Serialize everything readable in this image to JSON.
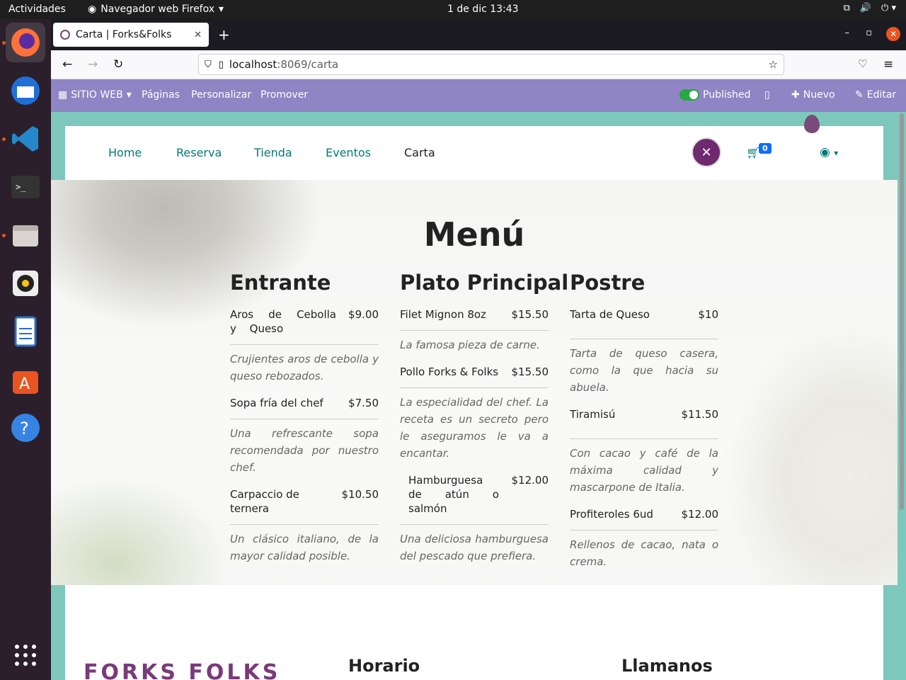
{
  "desktop": {
    "activities": "Actividades",
    "app_name": "Navegador web Firefox",
    "clock": "1 de dic  13:43"
  },
  "browser": {
    "tab_title": "Carta | Forks&Folks",
    "url_host": "localhost",
    "url_path": ":8069/carta"
  },
  "odoo_bar": {
    "website_label": "SITIO WEB",
    "pages": "Páginas",
    "customize": "Personalizar",
    "promote": "Promover",
    "published": "Published",
    "new": "Nuevo",
    "edit": "Editar"
  },
  "site": {
    "nav": [
      "Home",
      "Reserva",
      "Tienda",
      "Eventos",
      "Carta"
    ],
    "cart_count": "0",
    "menu_title": "Menú",
    "columns": [
      {
        "title": "Entrante",
        "items": [
          {
            "name": "Aros de Cebolla y Queso",
            "price": "$9.00",
            "desc": "Crujientes aros de cebolla y queso rebozados."
          },
          {
            "name": "Sopa fría del chef",
            "price": "$7.50",
            "desc": "Una refrescante sopa recomendada por nuestro chef."
          },
          {
            "name": "Carpaccio de ternera",
            "price": "$10.50",
            "desc": "Un clásico italiano, de la mayor calidad posible."
          }
        ]
      },
      {
        "title": "Plato Principal",
        "items": [
          {
            "name": "Filet Mignon 8oz",
            "price": "$15.50",
            "desc": "La famosa pieza de carne."
          },
          {
            "name": "Pollo Forks & Folks",
            "price": "$15.50",
            "desc": "La especialidad del chef. La receta es un secreto pero le aseguramos le va a encantar."
          },
          {
            "name": "Hamburguesa de atún o salmón",
            "price": "$12.00",
            "desc": "Una deliciosa hamburguesa del pescado que prefiera."
          }
        ]
      },
      {
        "title": "Postre",
        "items": [
          {
            "name": "Tarta de Queso",
            "price": "$10",
            "desc": "Tarta de queso casera, como la que hacia su abuela."
          },
          {
            "name": "Tiramisú",
            "price": "$11.50",
            "desc": "Con cacao y café de la máxima calidad y mascarpone de Italia."
          },
          {
            "name": "Profiteroles 6ud",
            "price": "$12.00",
            "desc": "Rellenos de cacao, nata o crema."
          }
        ]
      }
    ],
    "footer": {
      "logo_text": "FORKS FOLKS",
      "hours_title": "Horario",
      "call_title": "Llamanos"
    }
  }
}
